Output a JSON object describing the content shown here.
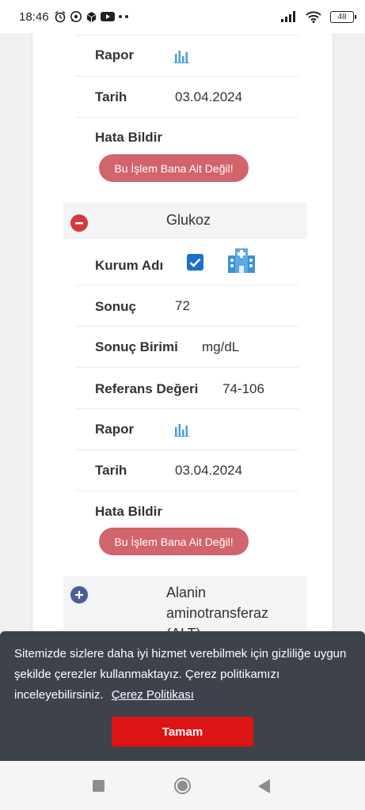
{
  "status_bar": {
    "time": "18:46",
    "battery": "48"
  },
  "labels": {
    "rapor": "Rapor",
    "tarih": "Tarih",
    "hata_bildir": "Hata Bildir",
    "kurum_adi": "Kurum Adı",
    "sonuc": "Sonuç",
    "sonuc_birimi": "Sonuç Birimi",
    "referans_degeri": "Referans Değeri"
  },
  "error_button_label": "Bu İşlem Bana Ait Değil!",
  "previous_record": {
    "tarih": "03.04.2024"
  },
  "glukoz": {
    "title": "Glukoz",
    "sonuc": "72",
    "sonuc_birimi": "mg/dL",
    "referans_degeri": "74-106",
    "tarih": "03.04.2024",
    "institution_checked": true
  },
  "next_section": {
    "title_line1": "Alanin",
    "title_line2": "aminotransferaz",
    "title_line3": "(ALT)"
  },
  "cookie_banner": {
    "text": "Sitemizde sizlere daha iyi hizmet verebilmek için gizliliğe uygun şekilde çerezler kullanmaktayız. Çerez politikamızı inceleyebilirsiniz.",
    "link": "Çerez Politikası",
    "button": "Tamam"
  },
  "colors": {
    "error_button": "#d2646c",
    "minus_toggle": "#d33a3e",
    "plus_toggle": "#4a5e93",
    "checkbox": "#1a6fd0",
    "chart_icon": "#4a9fd8",
    "cookie_bg": "#3e424a",
    "accept_button": "#dc1414"
  },
  "icons": {
    "rapor": "bar-chart-icon",
    "kurum": "hospital-icon",
    "toggle_expanded": "minus-icon",
    "toggle_collapsed": "plus-icon"
  }
}
